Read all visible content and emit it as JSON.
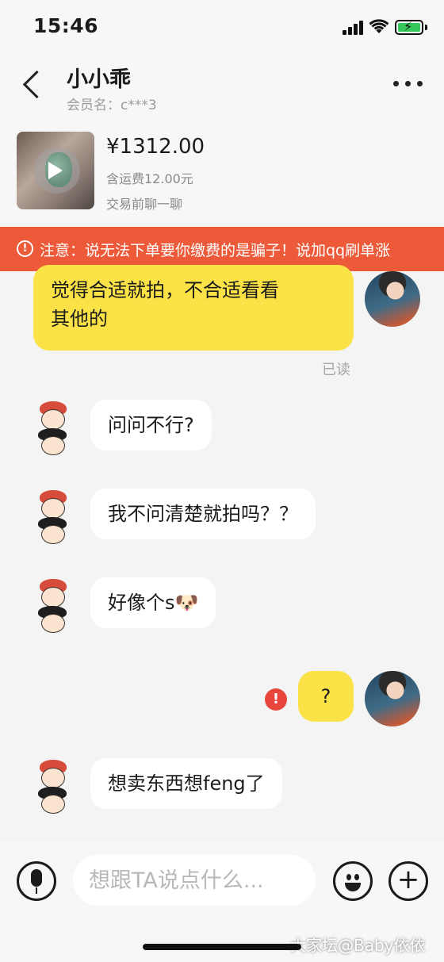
{
  "status_bar": {
    "time": "15:46"
  },
  "header": {
    "title": "小小乖",
    "member": "会员名：c***3"
  },
  "product": {
    "price": "¥1312.00",
    "shipping": "含运费12.00元",
    "prechat": "交易前聊一聊"
  },
  "warning": {
    "icon": "!",
    "text": "注意：说无法下单要你缴费的是骗子！说加qq刷单涨"
  },
  "messages": [
    {
      "side": "right",
      "text": "觉得合适就拍，不合适看看其他的",
      "line1": "觉得合适就拍，不合适看看",
      "line2": "其他的",
      "read": "已读"
    },
    {
      "side": "left",
      "text": "问问不行?"
    },
    {
      "side": "left",
      "text": "我不问清楚就拍吗？？"
    },
    {
      "side": "left",
      "text": "好像个s🐶"
    },
    {
      "side": "right",
      "text": "?",
      "failed_icon": "!"
    },
    {
      "side": "left",
      "text": "想卖东西想feng了"
    }
  ],
  "input": {
    "placeholder": "想跟TA说点什么..."
  },
  "plus_label": "+",
  "watermark": "大家坛@Baby依依",
  "colors": {
    "warning_bg": "#ec5a39",
    "bubble_self": "#fbe246",
    "bubble_other": "#ffffff",
    "error": "#e8453c",
    "battery": "#35c759"
  }
}
